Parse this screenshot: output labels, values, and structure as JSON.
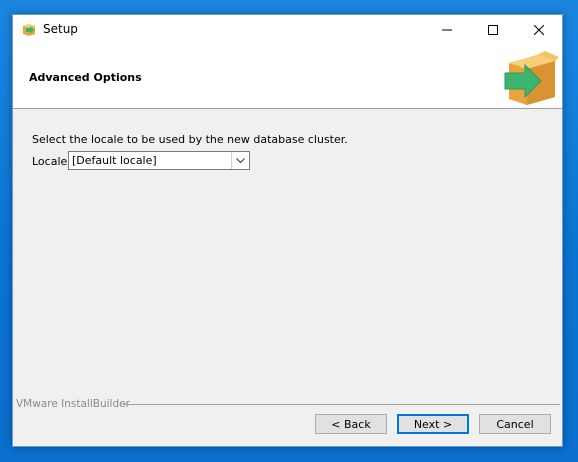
{
  "window": {
    "title": "Setup"
  },
  "header": {
    "title": "Advanced Options"
  },
  "content": {
    "description": "Select the locale to be used by the new database cluster.",
    "locale_label": "Locale",
    "locale_value": "[Default locale]"
  },
  "footer": {
    "brand": "VMware InstallBuilder",
    "back_label": "< Back",
    "next_label": "Next >",
    "cancel_label": "Cancel"
  },
  "colors": {
    "accent": "#0078d7",
    "logo_box": "#f0b74c",
    "logo_arrow": "#3cb371"
  }
}
